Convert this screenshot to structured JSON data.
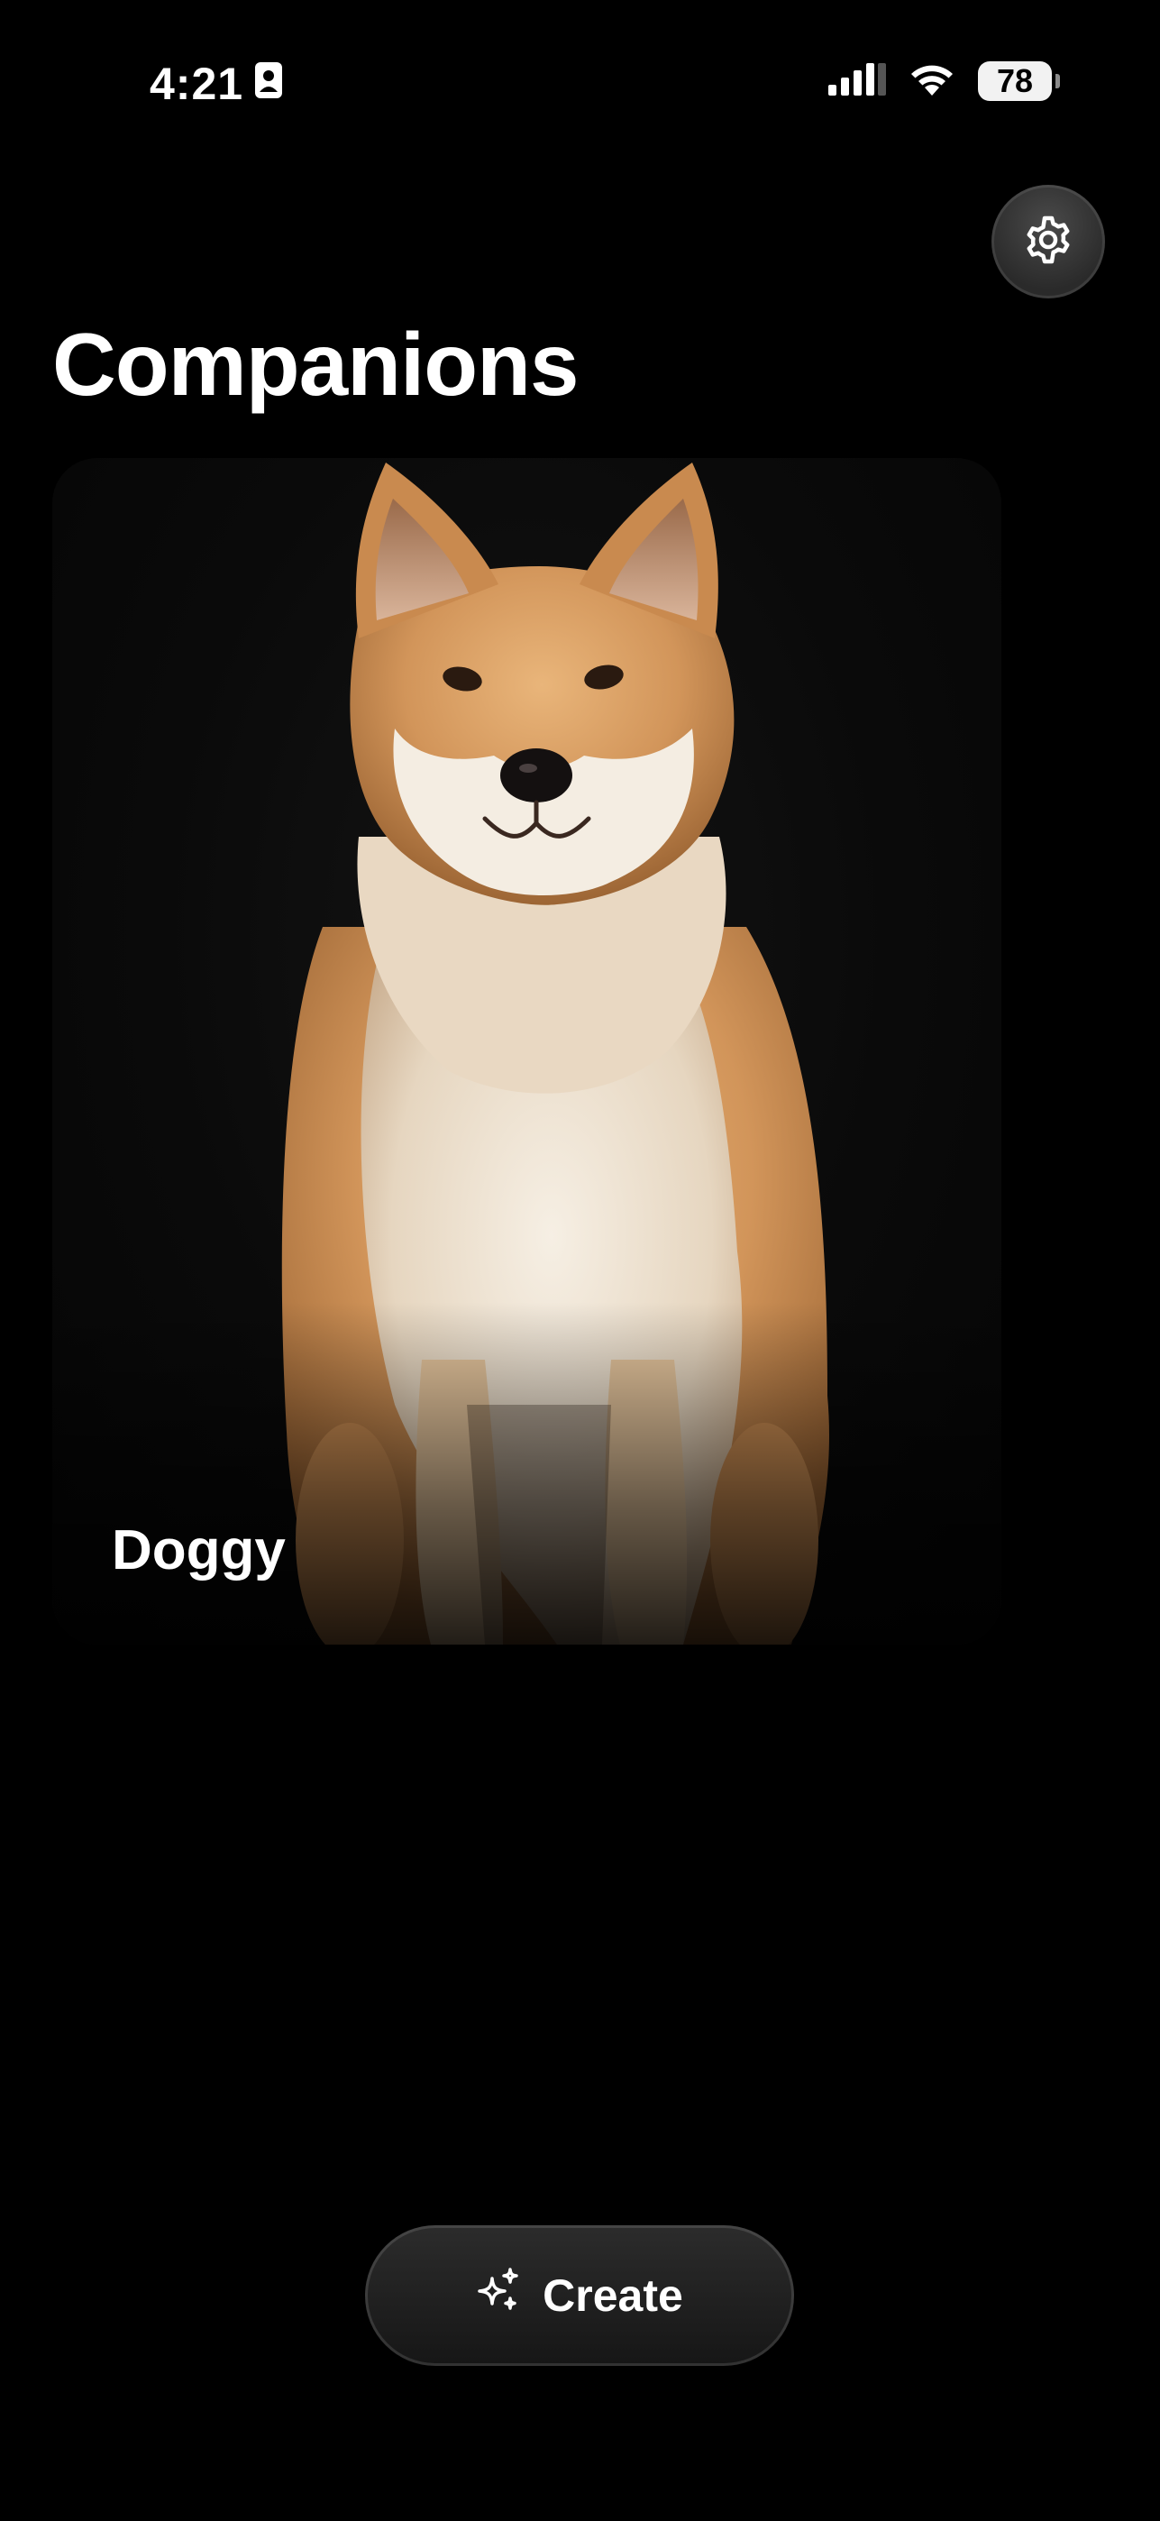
{
  "status_bar": {
    "time": "4:21",
    "battery_level": "78",
    "battery_percent": 78,
    "icons": [
      "contact-card-icon",
      "cellular-signal-icon",
      "wifi-icon",
      "battery-icon"
    ]
  },
  "header": {
    "title": "Companions",
    "settings_icon": "gear-icon"
  },
  "companions": [
    {
      "name": "Doggy",
      "image": "shiba-inu-dog-portrait"
    }
  ],
  "footer": {
    "create_label": "Create",
    "create_icon": "sparkles-icon"
  },
  "colors": {
    "background": "#000000",
    "text": "#ffffff",
    "button_bg": "#222222"
  }
}
